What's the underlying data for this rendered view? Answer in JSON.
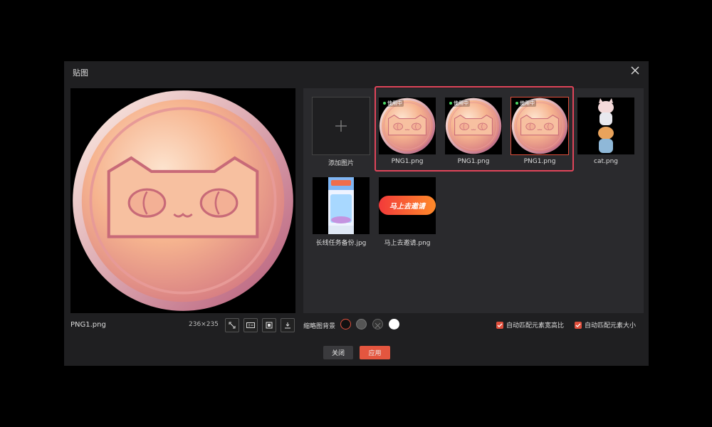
{
  "dialog": {
    "title": "贴图"
  },
  "preview": {
    "filename": "PNG1.png",
    "dimensions": "236×235"
  },
  "tiles": [
    {
      "label": "添加图片"
    },
    {
      "label": "PNG1.png",
      "badge": "使用中"
    },
    {
      "label": "PNG1.png",
      "badge": "使用中"
    },
    {
      "label": "PNG1.png",
      "badge": "使用中"
    },
    {
      "label": "cat.png"
    },
    {
      "label": "长线任务备份.jpg"
    },
    {
      "label": "马上去邀请.png",
      "image_text": "马上去邀请"
    }
  ],
  "thumb_bg": {
    "label": "缩略图背景"
  },
  "options": {
    "auto_ratio": "自动匹配元素宽高比",
    "auto_size": "自动匹配元素大小"
  },
  "buttons": {
    "close": "关闭",
    "apply": "应用"
  },
  "colors": {
    "accent": "#e4563f",
    "dialog_bg": "#1f1f21",
    "panel_bg": "#2a2a2d",
    "highlight": "#e0455a"
  },
  "icons": [
    "close-icon",
    "plus-icon",
    "fit-icon",
    "gif-icon",
    "crop-icon",
    "download-icon",
    "check-icon"
  ]
}
